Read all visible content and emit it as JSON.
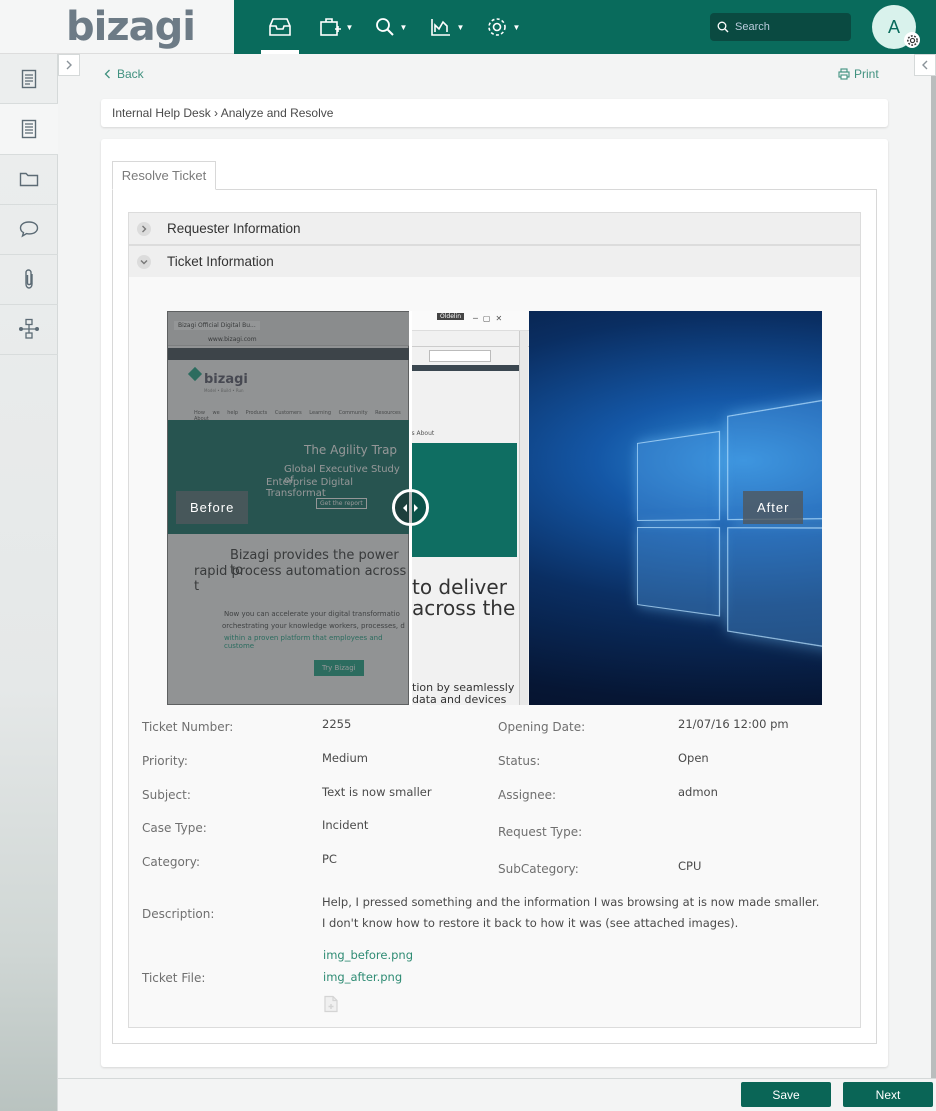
{
  "app": {
    "logo_text": "bizagi",
    "brand_color": "#096b5c",
    "accent_link_color": "#2f8c74"
  },
  "topnav": {
    "items": [
      {
        "name": "inbox-icon",
        "active": true
      },
      {
        "name": "new-case-icon",
        "has_dropdown": true
      },
      {
        "name": "search-icon",
        "has_dropdown": true
      },
      {
        "name": "analytics-icon",
        "has_dropdown": true
      },
      {
        "name": "settings-icon",
        "has_dropdown": true
      }
    ],
    "search_placeholder": "Search",
    "avatar_letter": "A"
  },
  "sidebar": {
    "items": [
      {
        "name": "case-summary-icon"
      },
      {
        "name": "forms-icon",
        "active": true
      },
      {
        "name": "folder-icon"
      },
      {
        "name": "comments-icon"
      },
      {
        "name": "attachments-icon"
      },
      {
        "name": "process-map-icon"
      }
    ]
  },
  "actions": {
    "back_label": "Back",
    "print_label": "Print"
  },
  "breadcrumb": "Internal Help Desk › Analyze and Resolve",
  "tabs": {
    "active": "Resolve Ticket"
  },
  "sections": {
    "requester": "Requester Information",
    "ticket": "Ticket Information"
  },
  "compare": {
    "before_label": "Before",
    "after_label": "After",
    "before_screen": {
      "tab_title": "Bizagi Official Digital Bu...",
      "url": "www.bizagi.com",
      "brand": "bizagi",
      "tagline": "Model • Build • Run",
      "nav": [
        "How we help",
        "Products",
        "Customers",
        "Learning",
        "Community",
        "Resources",
        "About"
      ],
      "hero_title": "The Agility Trap",
      "hero_sub1": "Global Executive Study of",
      "hero_sub2": "Enterprise Digital Transformat",
      "hero_cta": "Get the report",
      "line1": "Bizagi provides the power to",
      "line2": "rapid process automation across t",
      "para1": "Now you can accelerate your digital transformatio",
      "para2": "orchestrating your knowledge workers, processes, d",
      "para3": "within a proven platform that employees and custome",
      "try_btn": "Try Bizagi"
    },
    "after_screen": {
      "window_label": "Oldelin",
      "menu_text": "rs About",
      "big1": "to deliver",
      "big2": "across the",
      "small1": "tion by seamlessly",
      "small2": "data and devices"
    }
  },
  "ticket": {
    "number_label": "Ticket Number:",
    "number": "2255",
    "opening_date_label": "Opening Date:",
    "opening_date": "21/07/16 12:00 pm",
    "priority_label": "Priority:",
    "priority": "Medium",
    "status_label": "Status:",
    "status": "Open",
    "subject_label": "Subject:",
    "subject": "Text is now smaller",
    "assignee_label": "Assignee:",
    "assignee": "admon",
    "case_type_label": "Case Type:",
    "case_type": "Incident",
    "request_type_label": "Request Type:",
    "request_type": "",
    "category_label": "Category:",
    "category": "PC",
    "subcategory_label": "SubCategory:",
    "subcategory": "CPU",
    "description_label": "Description:",
    "description_line1": "Help, I pressed something and the information I was browsing at is now made smaller.",
    "description_line2": "I don't know how to restore it back to how it was (see attached images).",
    "file_label": "Ticket File:",
    "files": [
      "img_before.png",
      "img_after.png"
    ]
  },
  "buttons": {
    "save": "Save",
    "next": "Next"
  }
}
